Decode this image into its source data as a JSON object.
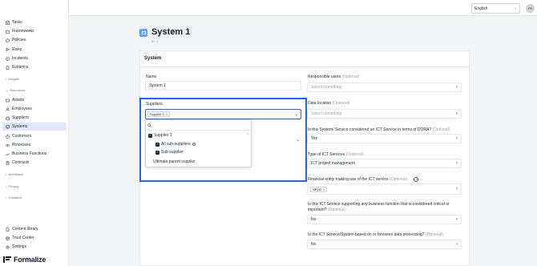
{
  "sidebar": {
    "items": [
      {
        "label": "Tasks",
        "icon": "tasks-icon"
      },
      {
        "label": "Frameworks",
        "icon": "frameworks-icon"
      },
      {
        "label": "Policies",
        "icon": "policies-icon"
      },
      {
        "label": "Risks",
        "icon": "risks-icon"
      },
      {
        "label": "Incidents",
        "icon": "incidents-icon"
      },
      {
        "label": "Evidence",
        "icon": "evidence-icon"
      }
    ],
    "groups": {
      "insights": "Insights",
      "resources": "Resources",
      "workflows": "Workflows",
      "privacy": "Privacy",
      "guidance": "Guidance"
    },
    "resources": [
      {
        "label": "Assets",
        "icon": "assets-icon"
      },
      {
        "label": "Employees",
        "icon": "employees-icon"
      },
      {
        "label": "Suppliers",
        "icon": "suppliers-icon"
      },
      {
        "label": "Systems",
        "icon": "systems-icon",
        "active": true
      },
      {
        "label": "Customers",
        "icon": "customers-icon"
      },
      {
        "label": "Processes",
        "icon": "processes-icon"
      },
      {
        "label": "Business Functions",
        "icon": "business-functions-icon"
      },
      {
        "label": "Contracts",
        "icon": "contracts-icon"
      }
    ],
    "bottom": [
      {
        "label": "Content library",
        "icon": "content-library-icon"
      },
      {
        "label": "Trust Center",
        "icon": "trust-center-icon"
      },
      {
        "label": "Settings",
        "icon": "settings-icon"
      }
    ],
    "logo_text": "Formalize"
  },
  "topbar": {
    "language": "English",
    "avatar_initials": "FS"
  },
  "page": {
    "title": "System 1",
    "id_label": "ID: 1"
  },
  "card": {
    "title": "System",
    "name_label": "Name",
    "name_value": "System 1",
    "suppliers_label": "Suppliers",
    "suppliers_tag": "Supplier 1",
    "dropdown": {
      "option_1": "Supplier 1",
      "option_1_sub": "All sub-suppliers",
      "option_1_sub2": "Sub supplier",
      "option_2": "Ultimate parent supplier"
    },
    "right": {
      "responsible_label": "Responsible users",
      "responsible_opt": "(Optional)",
      "responsible_placeholder": "Select something",
      "location_label": "Data location",
      "location_opt": "(Optional)",
      "location_placeholder": "Select something",
      "ict_label": "Is this System/ Service considered an ICT Service in terms of DORA?",
      "ict_opt": "(Optional)",
      "ict_value": "Yes",
      "type_label": "Type of ICT Services",
      "type_opt": "(Optional)",
      "type_value": "ICT project management",
      "financial_label": "Financial entity making use of the ICT service",
      "financial_opt": "(Optional)",
      "financial_tag": "XPTO",
      "critical_label": "Is this ICT Service supporting any business function that is considered critical or important?",
      "critical_opt": "(Optional)",
      "critical_value": "No",
      "foreseen_label": "Is the ICT Service/System based on or foresees data processing?",
      "foreseen_opt": "(Optional)",
      "foreseen_value": "No"
    }
  },
  "colors": {
    "accent": "#2563eb",
    "active_nav": "#e0e7ff",
    "title_icon": "#60a5fa"
  }
}
